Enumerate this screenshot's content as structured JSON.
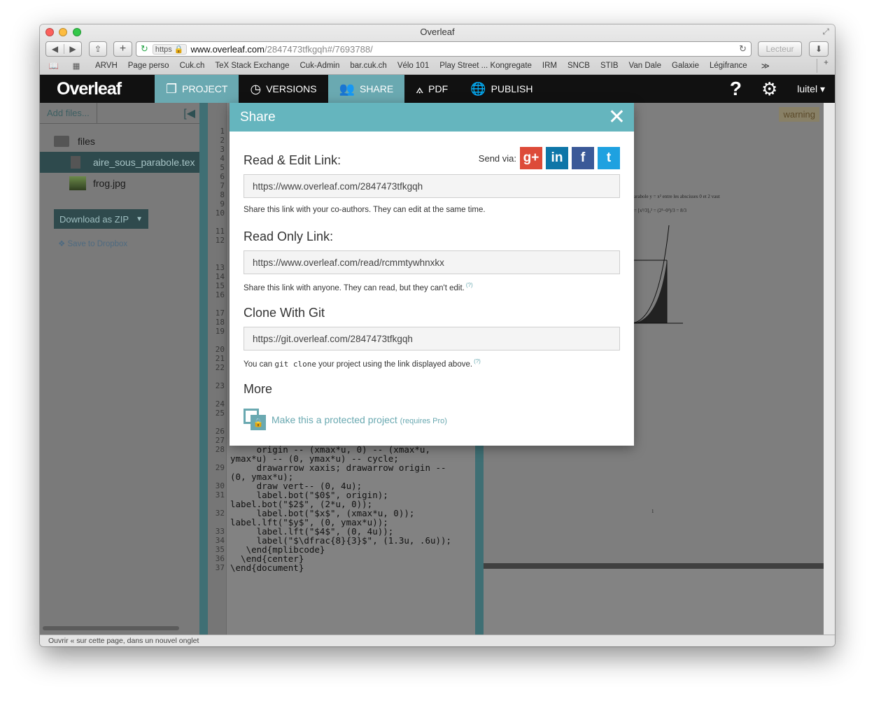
{
  "window": {
    "title": "Overleaf"
  },
  "toolbar": {
    "back": "◀",
    "forward": "▶",
    "share": "⇪",
    "add": "+",
    "reader_label": "Lecteur",
    "download": "⬇"
  },
  "urlbar": {
    "https": "https 🔒",
    "host": "www.overleaf.com",
    "path": "/2847473tfkgqh#/7693788/"
  },
  "bookmarks": [
    "ARVH",
    "Page perso",
    "Cuk.ch",
    "TeX Stack Exchange",
    "Cuk-Admin",
    "bar.cuk.ch",
    "Vélo 101",
    "Play Street ... Kongregate",
    "IRM",
    "SNCB",
    "STIB",
    "Van Dale",
    "Galaxie",
    "Légifrance"
  ],
  "overleaf_nav": {
    "logo": "Overleaf",
    "tabs": [
      {
        "label": "PROJECT",
        "active": true
      },
      {
        "label": "VERSIONS",
        "active": false
      },
      {
        "label": "SHARE",
        "active": true
      },
      {
        "label": "PDF",
        "active": false
      },
      {
        "label": "PUBLISH",
        "active": false
      }
    ],
    "help": "?",
    "user": "luitel"
  },
  "file_pane": {
    "add_files": "Add files...",
    "folder": "files",
    "files": [
      {
        "name": "aire_sous_parabole.tex",
        "selected": true
      },
      {
        "name": "frog.jpg",
        "selected": false
      }
    ],
    "download_zip": "Download as ZIP",
    "dropbox": "Save to Dropbox"
  },
  "editor": {
    "line_numbers": [
      "1",
      "2",
      "3",
      "4",
      "5",
      "6",
      "7",
      "8",
      "9",
      "10",
      "11",
      "12",
      "13",
      "14",
      "15",
      "16",
      "17",
      "18",
      "19",
      "20",
      "21",
      "22",
      "23",
      "24",
      "25",
      "26",
      "27",
      "28",
      "29",
      "30",
      "31",
      "32",
      "33",
      "34",
      "35",
      "36",
      "37"
    ],
    "code_lines": [
      "     origin -- (xmax*u, 0) -- (xmax*u,",
      "ymax*u) -- (0, ymax*u) -- cycle;",
      "     drawarrow xaxis; drawarrow origin --",
      "(0, ymax*u);",
      "     draw vert-- (0, 4u);",
      "     label.bot(\"$0$\", origin);",
      "label.bot(\"$2$\", (2*u, 0));",
      "     label.bot(\"$x$\", (xmax*u, 0));",
      "label.lft(\"$y$\", (0, ymax*u));",
      "     label.lft(\"$4$\", (0, 4u));",
      "     label(\"$\\dfrac{8}{3}$\", (1.3u, .6u));",
      "   \\end{mplibcode}",
      "  \\end{center}",
      "\\end{document}"
    ]
  },
  "pdf_pane": {
    "warning": "warning",
    "text_line": "arabole y = x² entre les abscisses 0 et 2 vaut",
    "formula": "= [x³/3]₀² = (2³−0³)/3 = 8/3",
    "page_number": "1"
  },
  "status_bar": "Ouvrir « sur cette page, dans un nouvel onglet",
  "share_modal": {
    "title": "Share",
    "close": "✕",
    "send_via": "Send via:",
    "social": {
      "gplus": "g+",
      "linkedin": "in",
      "facebook": "f",
      "twitter": "t"
    },
    "read_edit": {
      "title": "Read & Edit Link:",
      "url": "https://www.overleaf.com/2847473tfkgqh",
      "help": "Share this link with your co-authors. They can edit at the same time."
    },
    "read_only": {
      "title": "Read Only Link:",
      "url": "https://www.overleaf.com/read/rcmmtywhnxkx",
      "help": "Share this link with anyone. They can read, but they can't edit.",
      "help_sup": "(?)"
    },
    "git": {
      "title": "Clone With Git",
      "url": "https://git.overleaf.com/2847473tfkgqh",
      "help_before": "You can ",
      "help_code": "git clone",
      "help_after": " your project using the link displayed above.",
      "help_sup": "(?)"
    },
    "more": {
      "title": "More",
      "protect_link": "Make this a protected project",
      "protect_note": "(requires Pro)"
    }
  }
}
